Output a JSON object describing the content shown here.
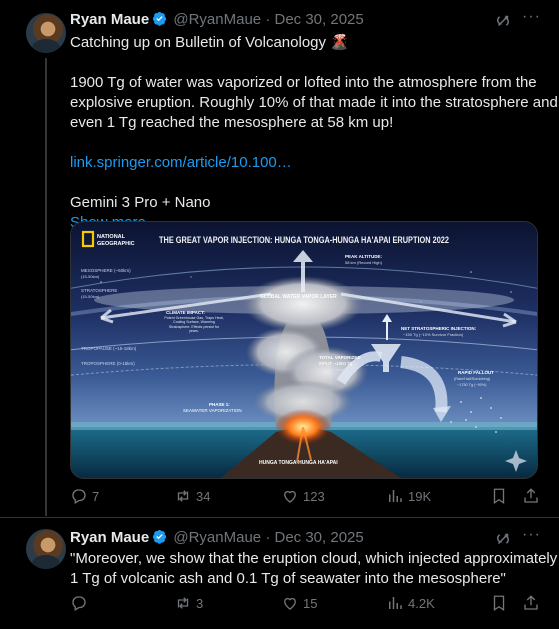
{
  "tweets": [
    {
      "name": "Ryan Maue",
      "handle": "@RyanMaue",
      "sep": "·",
      "date": "Dec 30, 2025",
      "lines": [
        "Catching up on Bulletin of Volcanology 🌋",
        "",
        "1900 Tg of water was vaporized or lofted into the atmosphere from the",
        "explosive eruption.  Roughly 10% of that made it into the stratosphere and",
        "even 1 Tg reached the mesosphere at 58 km up!",
        ""
      ],
      "link": "link.springer.com/article/10.100…",
      "footer_line": "Gemini 3 Pro + Nano",
      "show_more": "Show more",
      "image": {
        "logo_line1": "NATIONAL",
        "logo_line2": "GEOGRAPHIC",
        "title": "THE GREAT VAPOR INJECTION: HUNGA TONGA-HUNGA HA'APAI ERUPTION 2022",
        "peak": "PEAK ALTITUDE:",
        "peak_sub": "58 km (Record High)",
        "mesosphere": "MESOSPHERE (~50km)",
        "mesosphere_sub": "(15-50km)",
        "stratosphere": "STRATOSPHERE",
        "stratosphere_sub": "(15-50km)",
        "global_layer": "GLOBAL WATER VAPOR LAYER",
        "climate": "CLIMATE IMPACT:",
        "climate_sub": "Potent Greenhouse Gas, Traps Heat, Cooling Surface, Warming Stratosphere. Effects persist for years.",
        "net": "NET STRATOSPHERIC INJECTION:",
        "net_sub": "~150 Tg (~10% Survivor Fraction)",
        "tropopause": "TROPOPAUSE (~15-18km)",
        "troposphere": "TROPOSPHERE (0-15km)",
        "total": "TOTAL VAPORIZED",
        "total_sub": "INPUT: ~1900 Tg",
        "total_sub2": "(1.9 Billion Metric Tons)",
        "fallout": "RAPID FALLOUT",
        "fallout_sub": "(Rain/Hail/Scrubbing)",
        "fallout_sub2": "~1750 Tg (~90%)",
        "phase": "PHASE 1:",
        "phase_sub": "SEAWATER VAPORIZATION",
        "volcano": "HUNGA TONGA-HUNGA HA'APAI"
      },
      "actions": {
        "replies": "7",
        "reposts": "34",
        "likes": "123",
        "views": "19K"
      }
    },
    {
      "name": "Ryan Maue",
      "handle": "@RyanMaue",
      "sep": "·",
      "date": "Dec 30, 2025",
      "lines": [
        "\"Moreover, we show that the eruption cloud, which injected approximately",
        "1 Tg of volcanic ash and 0.1 Tg of seawater into the mesosphere\""
      ],
      "actions": {
        "replies": "",
        "reposts": "3",
        "likes": "15",
        "views": "4.2K"
      }
    }
  ],
  "colors": {
    "accent": "#1d9bf0",
    "muted": "#71767b",
    "text": "#e7e9ea",
    "bg": "#000000"
  }
}
